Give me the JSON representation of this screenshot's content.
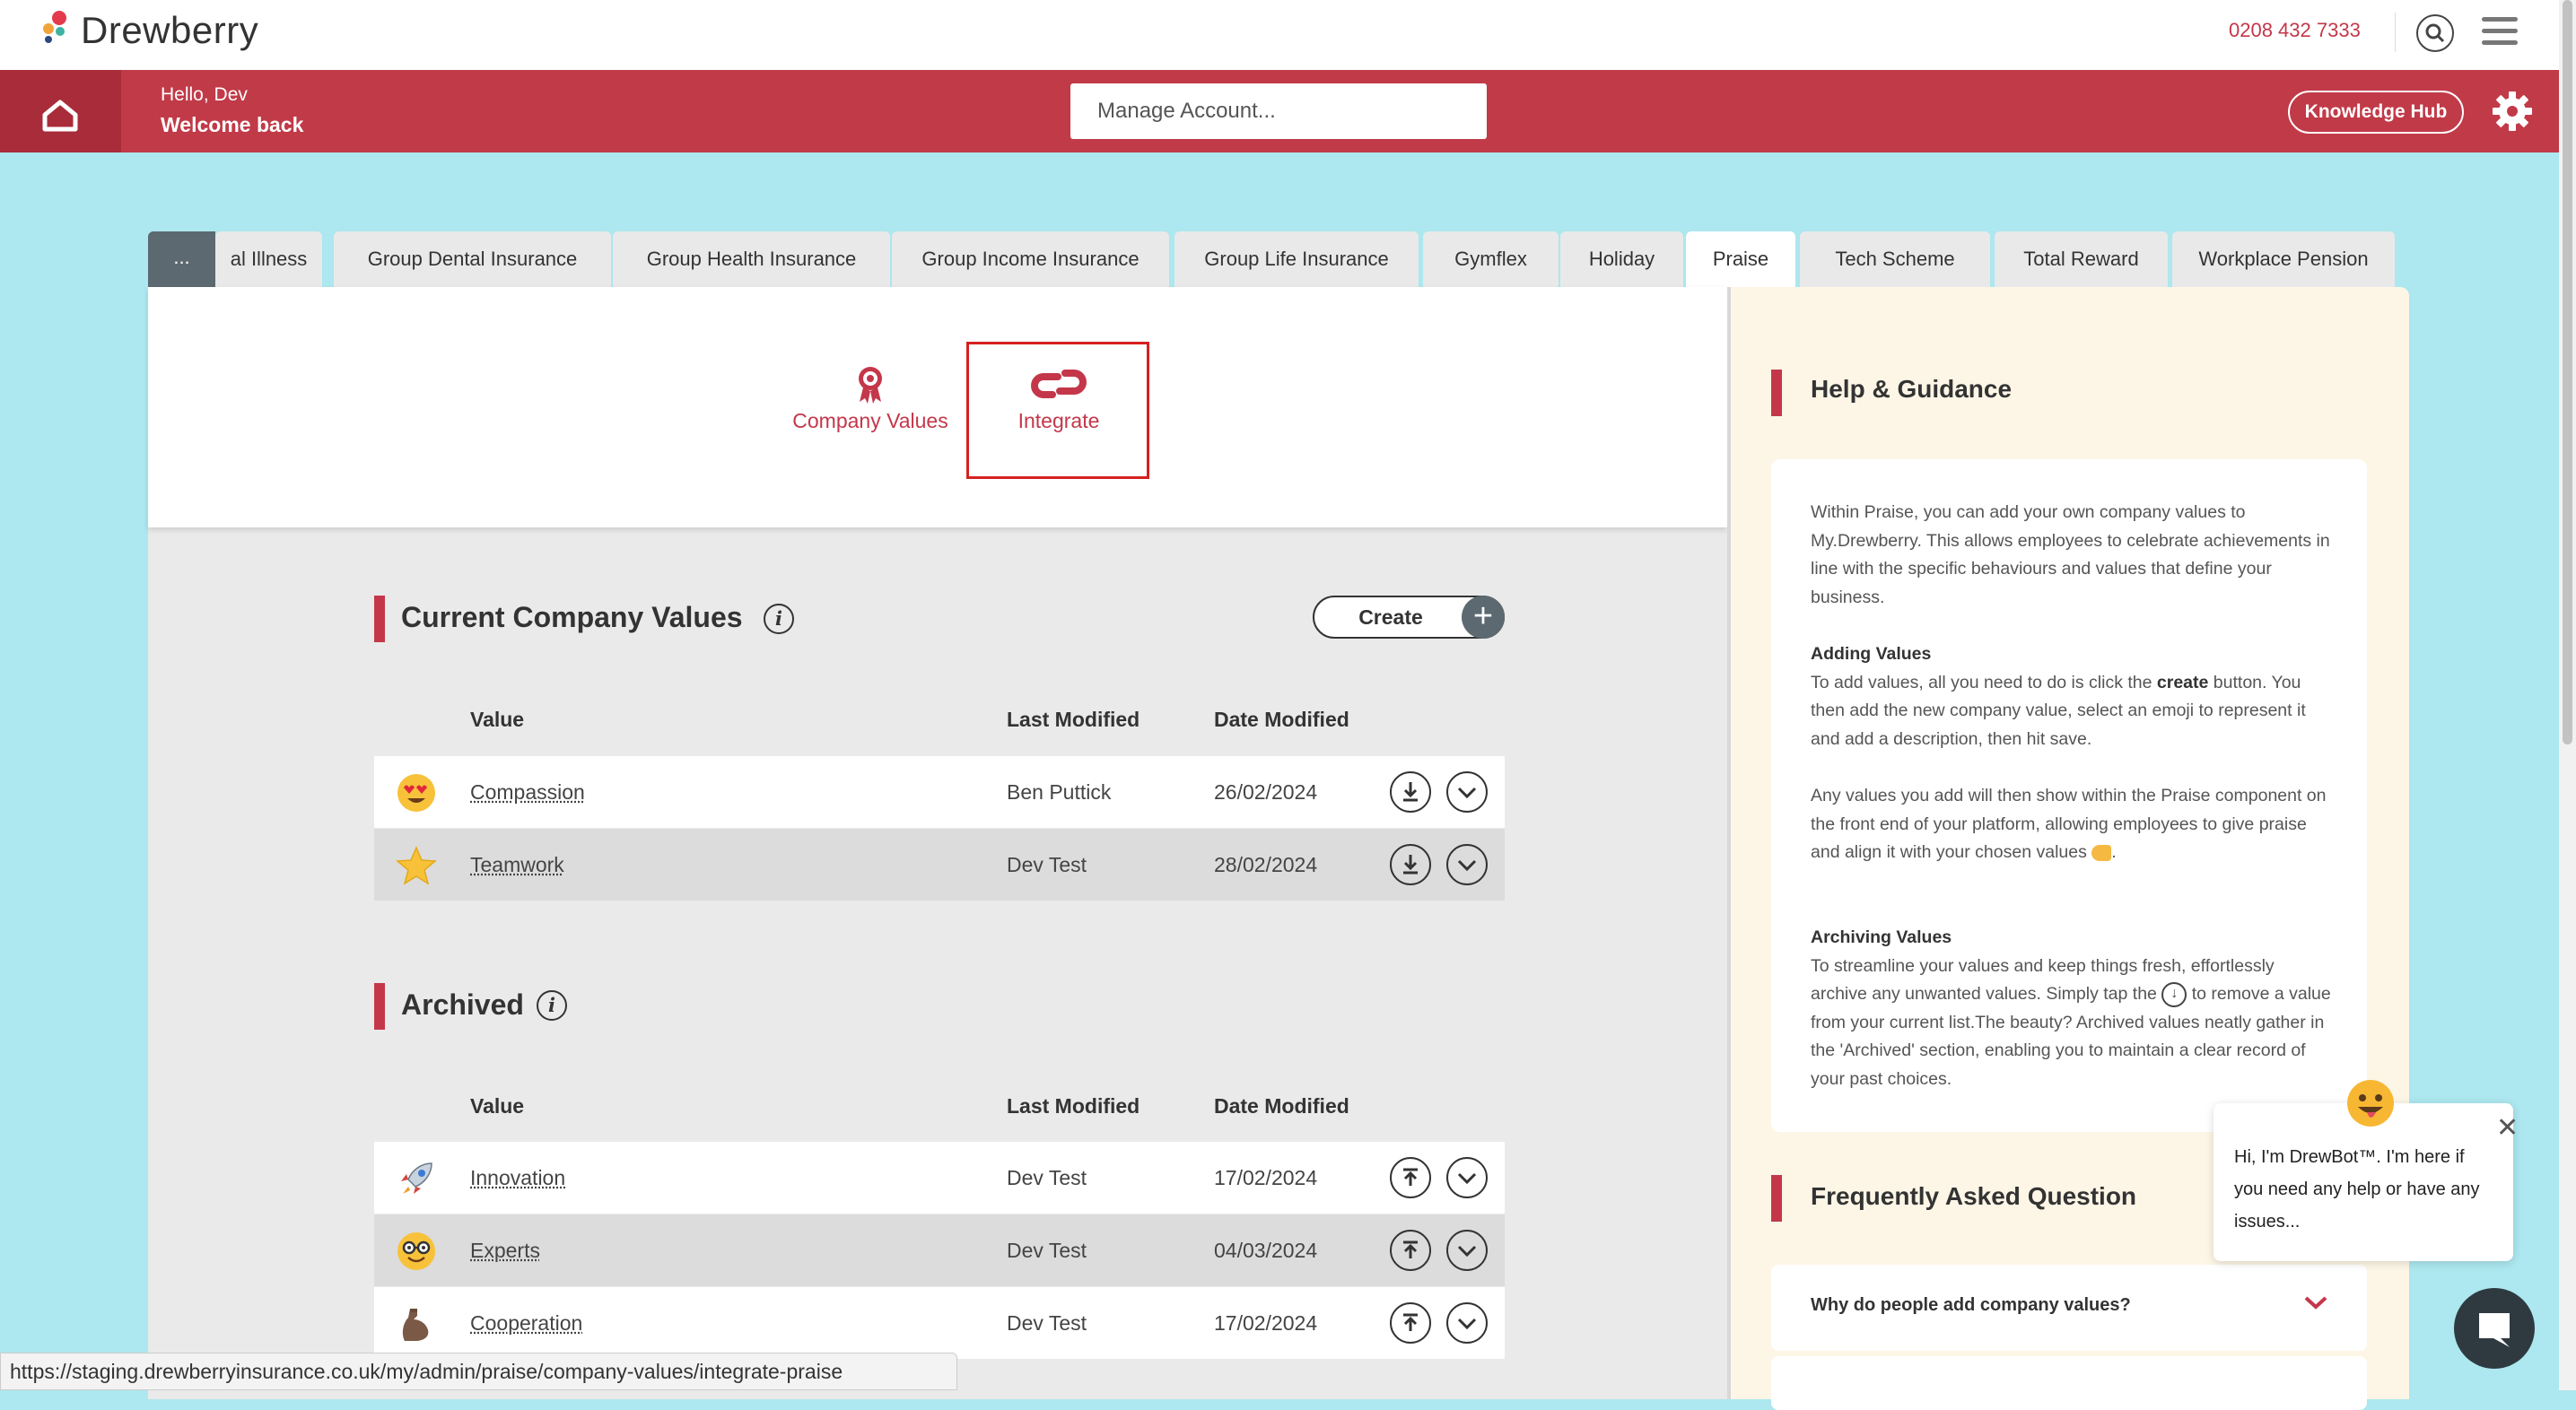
{
  "header": {
    "brand": "Drewberry",
    "phone": "0208 432 7333",
    "greeting": "Hello, Dev",
    "welcome": "Welcome back",
    "account_select": "Manage Account...",
    "knowledge_hub": "Knowledge Hub"
  },
  "tabs": {
    "more": "...",
    "items": [
      "al Illness",
      "Group Dental Insurance",
      "Group Health Insurance",
      "Group Income Insurance",
      "Group Life Insurance",
      "Gymflex",
      "Holiday",
      "Praise",
      "Tech Scheme",
      "Total Reward",
      "Workplace Pension"
    ],
    "active": "Praise"
  },
  "subnav": {
    "company_values": "Company Values",
    "integrate": "Integrate"
  },
  "current": {
    "title": "Current Company Values",
    "create": "Create",
    "columns": [
      "Value",
      "Last Modified",
      "Date Modified"
    ],
    "rows": [
      {
        "emoji": "heart-eyes",
        "value": "Compassion",
        "modified_by": "Ben Puttick",
        "date": "26/02/2024"
      },
      {
        "emoji": "star",
        "value": "Teamwork",
        "modified_by": "Dev Test",
        "date": "28/02/2024"
      }
    ]
  },
  "archived": {
    "title": "Archived",
    "columns": [
      "Value",
      "Last Modified",
      "Date Modified"
    ],
    "rows": [
      {
        "emoji": "rocket",
        "value": "Innovation",
        "modified_by": "Dev Test",
        "date": "17/02/2024"
      },
      {
        "emoji": "nerd-face",
        "value": "Experts",
        "modified_by": "Dev Test",
        "date": "04/03/2024"
      },
      {
        "emoji": "flexed-biceps",
        "value": "Cooperation",
        "modified_by": "Dev Test",
        "date": "17/02/2024"
      }
    ]
  },
  "help": {
    "title": "Help & Guidance",
    "intro": "Within Praise, you can add your own company values to My.Drewberry. This allows employees to celebrate achievements in line with the specific behaviours and values that define your business.",
    "adding_title": "Adding Values",
    "adding_pre": "To add values, all you need to do is click the ",
    "adding_bold": "create",
    "adding_post": " button. You then add the new company value, select an emoji to represent it and add a description, then hit save.",
    "any_values": "Any values you add will then show within the Praise component on the front end of your platform, allowing employees to give praise and align it with your chosen values",
    "archiving_title": "Archiving Values",
    "archiving_pre": "To streamline your values and keep things fresh, effortlessly archive any unwanted values. Simply tap the",
    "archiving_post": "to remove a value from your current list.The beauty? Archived values neatly gather in the 'Archived' section, enabling you to maintain a clear record of your past choices."
  },
  "faq": {
    "title": "Frequently Asked Question",
    "q1": "Why do people add company values?"
  },
  "chatbot": {
    "message": "Hi, I'm DrewBot™. I'm here if you need any help or have any issues..."
  },
  "status_url": "https://staging.drewberryinsurance.co.uk/my/admin/praise/company-values/integrate-praise",
  "colors": {
    "brand_red": "#c13a48",
    "accent": "#c4374a",
    "background": "#ade7ef"
  }
}
